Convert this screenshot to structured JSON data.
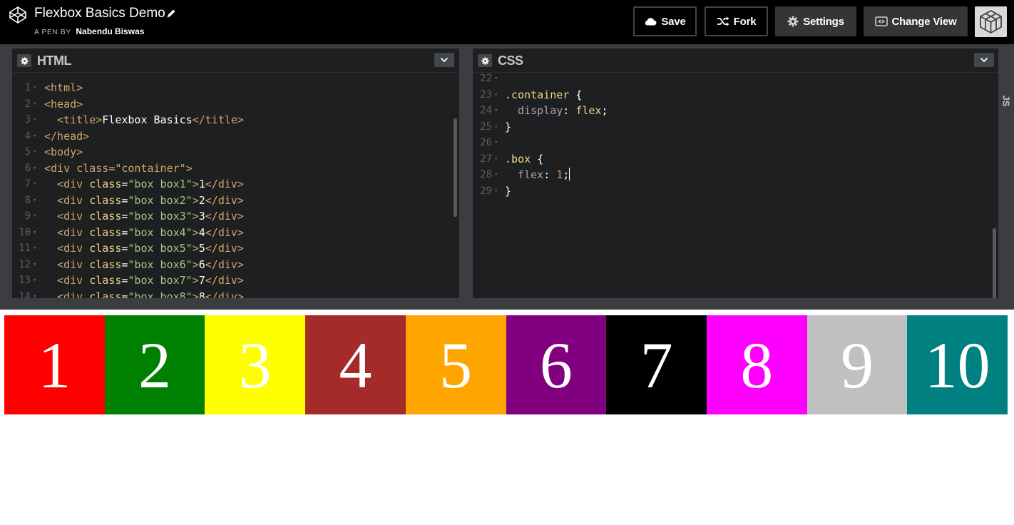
{
  "header": {
    "title": "Flexbox Basics Demo",
    "byline_prefix": "A PEN BY",
    "author": "Nabendu Biswas",
    "buttons": {
      "save": "Save",
      "fork": "Fork",
      "settings": "Settings",
      "change_view": "Change View"
    }
  },
  "html_editor": {
    "title": "HTML",
    "line_numbers": [
      "1",
      "2",
      "3",
      "4",
      "5",
      "6",
      "7",
      "8",
      "9",
      "10",
      "11",
      "12",
      "13",
      "14"
    ],
    "lines": [
      [
        "<html>"
      ],
      [
        "<head>"
      ],
      [
        "  <title>",
        "Flexbox Basics",
        "</title>"
      ],
      [
        "</head>"
      ],
      [
        "<body>"
      ],
      [
        "<div ",
        "class",
        "=",
        "\"container\"",
        ">"
      ],
      [
        "  <div ",
        "class",
        "=",
        "\"box box1\"",
        ">",
        "1",
        "</div>"
      ],
      [
        "  <div ",
        "class",
        "=",
        "\"box box2\"",
        ">",
        "2",
        "</div>"
      ],
      [
        "  <div ",
        "class",
        "=",
        "\"box box3\"",
        ">",
        "3",
        "</div>"
      ],
      [
        "  <div ",
        "class",
        "=",
        "\"box box4\"",
        ">",
        "4",
        "</div>"
      ],
      [
        "  <div ",
        "class",
        "=",
        "\"box box5\"",
        ">",
        "5",
        "</div>"
      ],
      [
        "  <div ",
        "class",
        "=",
        "\"box box6\"",
        ">",
        "6",
        "</div>"
      ],
      [
        "  <div ",
        "class",
        "=",
        "\"box box7\"",
        ">",
        "7",
        "</div>"
      ],
      [
        "  <div ",
        "class",
        "=",
        "\"box box8\"",
        ">",
        "8",
        "</div>"
      ]
    ]
  },
  "css_editor": {
    "title": "CSS",
    "line_numbers": [
      "22",
      "23",
      "24",
      "25",
      "26",
      "27",
      "28",
      "29"
    ],
    "lines": [
      [
        ""
      ],
      [
        ".container",
        " {"
      ],
      [
        "  display",
        ": ",
        "flex",
        ";"
      ],
      [
        "}"
      ],
      [
        ""
      ],
      [
        ".box",
        " {"
      ],
      [
        "  flex",
        ": ",
        "1",
        ";"
      ],
      [
        "}"
      ]
    ]
  },
  "js_editor": {
    "title": "JS"
  },
  "result": {
    "boxes": [
      {
        "label": "1",
        "color": "#ff0000"
      },
      {
        "label": "2",
        "color": "#008000"
      },
      {
        "label": "3",
        "color": "#ffff00"
      },
      {
        "label": "4",
        "color": "#a52a2a"
      },
      {
        "label": "5",
        "color": "#ffa500"
      },
      {
        "label": "6",
        "color": "#800080"
      },
      {
        "label": "7",
        "color": "#000000"
      },
      {
        "label": "8",
        "color": "#ff00ff"
      },
      {
        "label": "9",
        "color": "#c0c0c0"
      },
      {
        "label": "10",
        "color": "#008080"
      }
    ]
  }
}
